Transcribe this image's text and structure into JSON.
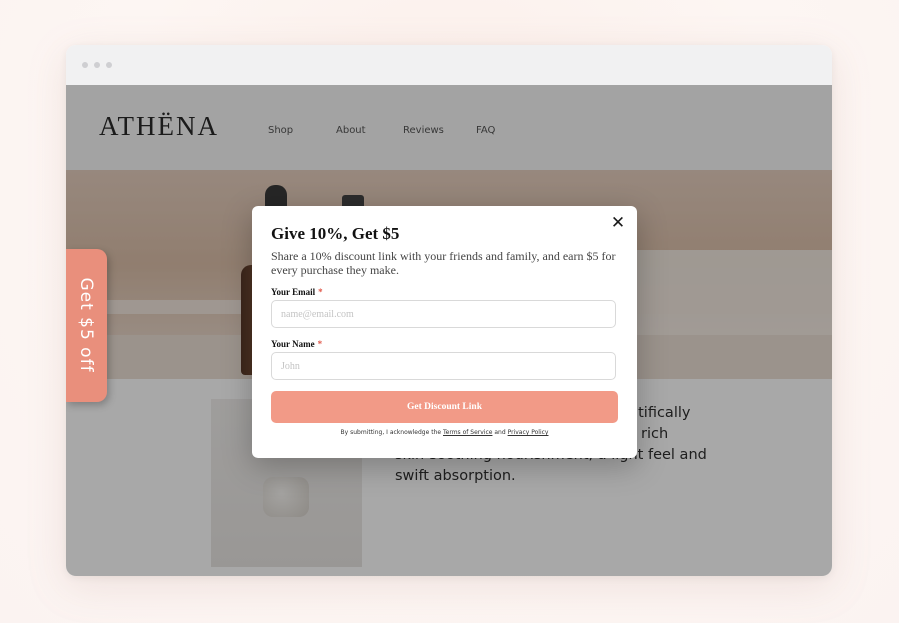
{
  "site": {
    "logo": "ATHËNA",
    "nav": [
      "Shop",
      "About",
      "Reviews",
      "FAQ"
    ],
    "description": "…entifically rich skin-soothing nourishment, a light feel and swift absorption.",
    "desc_lines": [
      "entifically",
      "rich",
      "skin-soothing nourishment, a light feel and",
      "swift absorption."
    ]
  },
  "side_tab": {
    "label": "Get $5 off"
  },
  "modal": {
    "title": "Give 10%, Get $5",
    "subtitle": "Share a 10% discount link with your friends and family, and earn $5 for every purchase they make.",
    "email_label": "Your Email",
    "email_placeholder": "name@email.com",
    "name_label": "Your Name",
    "name_placeholder": "John",
    "required_mark": "*",
    "submit_label": "Get Discount Link",
    "legal_prefix": "By submitting, I acknowledge the",
    "terms_label": "Terms of Service",
    "legal_and": "and",
    "privacy_label": "Privacy Policy",
    "close_icon": "close-icon"
  },
  "colors": {
    "accent": "#f29a87",
    "side_tab": "#e98f7c",
    "required": "#e0584a"
  }
}
